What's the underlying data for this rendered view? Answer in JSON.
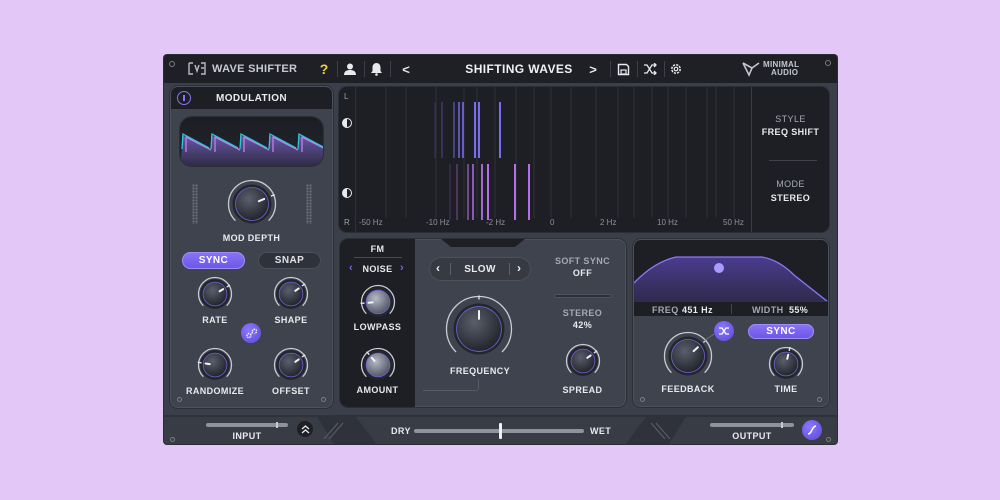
{
  "app": {
    "name": "WAVE SHIFTER",
    "brand": "MINIMAL AUDIO",
    "brand_line1": "MINIMAL",
    "brand_line2": "AUDIO"
  },
  "topbar": {
    "help_icon": "question-icon",
    "preset_name": "SHIFTING WAVES",
    "prev_label": "<",
    "next_label": ">",
    "icons": [
      "user-icon",
      "bell-icon",
      "save-icon",
      "shuffle-icon",
      "gear-icon"
    ]
  },
  "modulation": {
    "title": "MODULATION",
    "mod_depth_label": "MOD DEPTH",
    "sync_label": "SYNC",
    "snap_label": "SNAP",
    "sync_active": true,
    "snap_active": false,
    "rate_label": "RATE",
    "shape_label": "SHAPE",
    "randomize_label": "RANDOMIZE",
    "offset_label": "OFFSET",
    "knobs": {
      "mod_depth": 0.75,
      "rate": 0.72,
      "shape": 0.7,
      "randomize": 0.2,
      "offset": 0.7
    }
  },
  "spectrum": {
    "left_label": "L",
    "right_label": "R",
    "ticks": [
      "-50 Hz",
      "-10 Hz",
      "-2 Hz",
      "0",
      "2 Hz",
      "10 Hz",
      "50 Hz"
    ]
  },
  "style_mode": {
    "style_label": "STYLE",
    "style_value": "FREQ SHIFT",
    "mode_label": "MODE",
    "mode_value": "STEREO"
  },
  "fm": {
    "title": "FM",
    "source": "NOISE",
    "lowpass_label": "LOWPASS",
    "amount_label": "AMOUNT",
    "knobs": {
      "lowpass": 0.15,
      "amount": 0.35
    }
  },
  "shifter": {
    "speed": "SLOW",
    "frequency_label": "FREQUENCY",
    "frequency_value": 0.5,
    "soft_sync_label": "SOFT SYNC",
    "soft_sync_value": "OFF",
    "stereo_label": "STEREO",
    "stereo_value": "42%",
    "spread_label": "SPREAD",
    "spread_value": 0.7
  },
  "filter": {
    "freq_label": "FREQ",
    "freq_value": "451 Hz",
    "width_label": "WIDTH",
    "width_value": "55%",
    "feedback_label": "FEEDBACK",
    "feedback_value": 0.68,
    "time_label": "TIME",
    "time_value": 0.55,
    "sync_label": "SYNC",
    "sync_active": true
  },
  "bottom": {
    "input_label": "INPUT",
    "output_label": "OUTPUT",
    "dry_label": "DRY",
    "wet_label": "WET",
    "input_level": 0.85,
    "output_level": 0.85,
    "dry_wet": 0.5
  },
  "colors": {
    "accent": "#7b65f0",
    "background": "#e3c7f7",
    "panel": "#3f434d",
    "dark": "#1d1f24",
    "left_bars": "#7a6cf0",
    "right_bars": "#b36ee8"
  }
}
